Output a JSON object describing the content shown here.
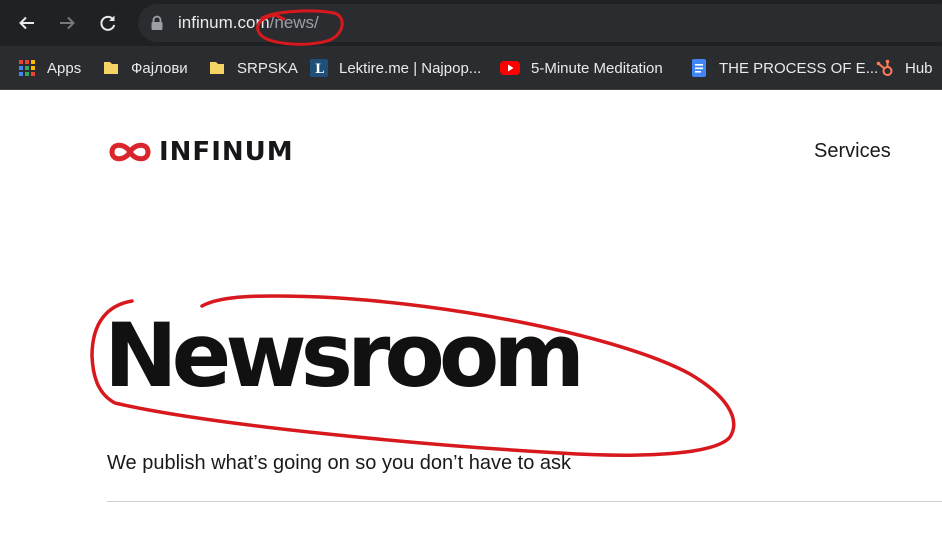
{
  "browser": {
    "url_host": "infinum.com",
    "url_path": "/news/",
    "bookmarks": [
      {
        "label": "Apps",
        "icon": "apps-grid-icon"
      },
      {
        "label": "Фајлови",
        "icon": "folder-icon"
      },
      {
        "label": "SRPSKA",
        "icon": "folder-icon"
      },
      {
        "label": "Lektire.me | Najpop...",
        "icon": "lektire-favicon-icon"
      },
      {
        "label": "5-Minute Meditation",
        "icon": "youtube-icon"
      },
      {
        "label": "THE PROCESS OF E...",
        "icon": "google-docs-icon"
      },
      {
        "label": "Hub",
        "icon": "hubspot-icon"
      }
    ]
  },
  "site": {
    "logo_text": "INFINUM",
    "nav_services": "Services",
    "heading": "Newsroom",
    "tagline": "We publish what’s going on so you don’t have to ask"
  },
  "colors": {
    "brand_red": "#d9262c",
    "annotation_red": "#d7191e",
    "chrome_dark": "#202124"
  }
}
